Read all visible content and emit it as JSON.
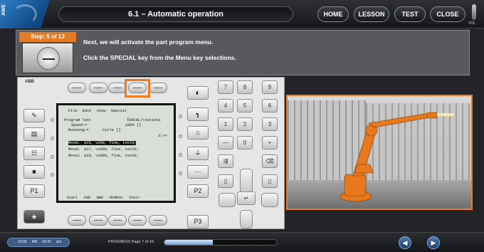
{
  "header": {
    "logo_text": "AWE",
    "title": "6.1 – Automatic operation",
    "buttons": [
      "HOME",
      "LESSON",
      "TEST",
      "CLOSE"
    ],
    "volume_label": "VOL"
  },
  "instruction": {
    "step": "Step: 5 of 13",
    "line1": "Next, we will activate the part program menu.",
    "line2": "Click the SPECIAL key from the Menu key selections."
  },
  "pendant": {
    "brand": "ABB",
    "screen": {
      "menu": "File  Edit  View  Special",
      "header1_left": "Program Test",
      "header1_right": "TENCHL/routine1",
      "speed_label": "Speed:=",
      "speed_value": "100% []",
      "running_label": "Running:=",
      "running_value": "Cycle []",
      "scroll_marker": "3:>>",
      "code_lines": [
        "MoveL  p15, v200, fine, tool0;",
        "MoveL  p17, v1000, fine, tool0;",
        "MoveJ  p20, v1000, fine, tool0;"
      ],
      "footer": "Start  FWD  BWD  ModPos  Instr-"
    },
    "left_keys": [
      "P1"
    ],
    "right_keys": [
      "P2",
      "P3"
    ],
    "numpad": [
      "7",
      "8",
      "9",
      "4",
      "5",
      "6",
      "1",
      "2",
      "3",
      "—",
      "0",
      "•"
    ]
  },
  "footer": {
    "time": "10:00 AM  02:47 pm",
    "progress_label": "PROGRESS Page 7 of 16",
    "progress_fraction": 0.43
  },
  "colors": {
    "accent": "#f07a20",
    "brand_blue": "#1f5fa0"
  },
  "icons": [
    "speaker-icon",
    "prev-arrow-icon",
    "next-arrow-icon",
    "stop-icon",
    "backspace-icon",
    "enter-icon"
  ]
}
